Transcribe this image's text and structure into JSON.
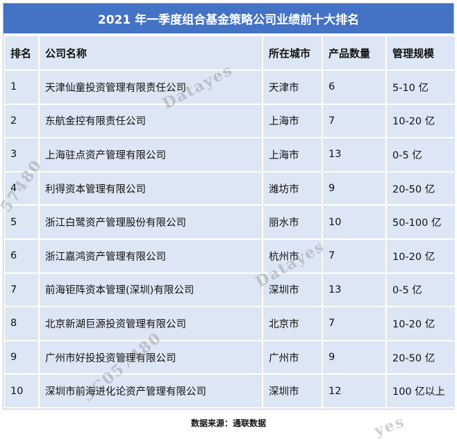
{
  "table": {
    "title": "2021 年一季度组合基金策略公司业绩前十大排名",
    "headers": {
      "rank": "排名",
      "name": "公司名称",
      "city": "所在城市",
      "count": "产品数量",
      "scale": "管理规模"
    },
    "rows": [
      {
        "rank": "1",
        "name": "天津仙童投资管理有限责任公司",
        "city": "天津市",
        "count": "6",
        "scale": "5-10 亿"
      },
      {
        "rank": "2",
        "name": "东航金控有限责任公司",
        "city": "上海市",
        "count": "7",
        "scale": "10-20 亿"
      },
      {
        "rank": "3",
        "name": "上海驻点资产管理有限公司",
        "city": "上海市",
        "count": "13",
        "scale": "0-5 亿"
      },
      {
        "rank": "4",
        "name": "利得资本管理有限公司",
        "city": "潍坊市",
        "count": "9",
        "scale": "20-50 亿"
      },
      {
        "rank": "5",
        "name": "浙江白鹭资产管理股份有限公司",
        "city": "丽水市",
        "count": "10",
        "scale": "50-100 亿"
      },
      {
        "rank": "6",
        "name": "浙江嘉鸿资产管理有限公司",
        "city": "杭州市",
        "count": "7",
        "scale": "10-20 亿"
      },
      {
        "rank": "7",
        "name": "前海钜阵资本管理(深圳)有限公司",
        "city": "深圳市",
        "count": "13",
        "scale": "0-5 亿"
      },
      {
        "rank": "8",
        "name": "北京新湖巨源投资管理有限公司",
        "city": "北京市",
        "count": "7",
        "scale": "10-20 亿"
      },
      {
        "rank": "9",
        "name": "广州市好投投资管理有限公司",
        "city": "广州市",
        "count": "9",
        "scale": "20-50 亿"
      },
      {
        "rank": "10",
        "name": "深圳市前海进化论资产管理有限公司",
        "city": "深圳市",
        "count": "12",
        "scale": "100 亿以上"
      }
    ]
  },
  "source": "数据来源：通联数据",
  "watermarks": [
    "Datayes",
    "57480",
    "Datayes",
    "3C057480",
    "yes"
  ],
  "colors": {
    "title_bg": "#4472c4",
    "cell_bg": "#dde6f4"
  }
}
